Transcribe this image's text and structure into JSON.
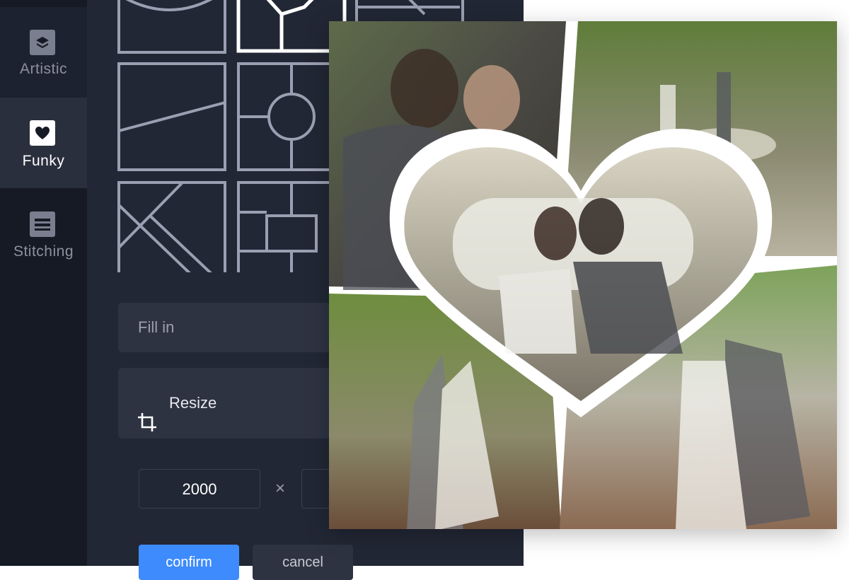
{
  "sidebar": {
    "items": [
      {
        "label": "Artistic",
        "icon": "layers-icon"
      },
      {
        "label": "Funky",
        "icon": "heart-icon",
        "active": true
      },
      {
        "label": "Stitching",
        "icon": "stitching-icon"
      }
    ]
  },
  "options": {
    "fill_label": "Fill in",
    "resize_label": "Resize"
  },
  "size": {
    "width": "2000",
    "separator": "×"
  },
  "buttons": {
    "confirm": "confirm",
    "cancel": "cancel"
  },
  "colors": {
    "app_bg": "#222735",
    "sidebar_bg": "#161a24",
    "panel_bg": "#2e3342",
    "accent": "#3d8bfd",
    "template_stroke": "#9a9fb2",
    "selected_stroke": "#ffffff"
  },
  "collage": {
    "layout": "funky-heart",
    "photos": [
      "couple-kiss-forehead",
      "couple-by-car",
      "couple-kiss-in-car",
      "couple-standing-trees",
      "couple-hug-by-car"
    ]
  }
}
